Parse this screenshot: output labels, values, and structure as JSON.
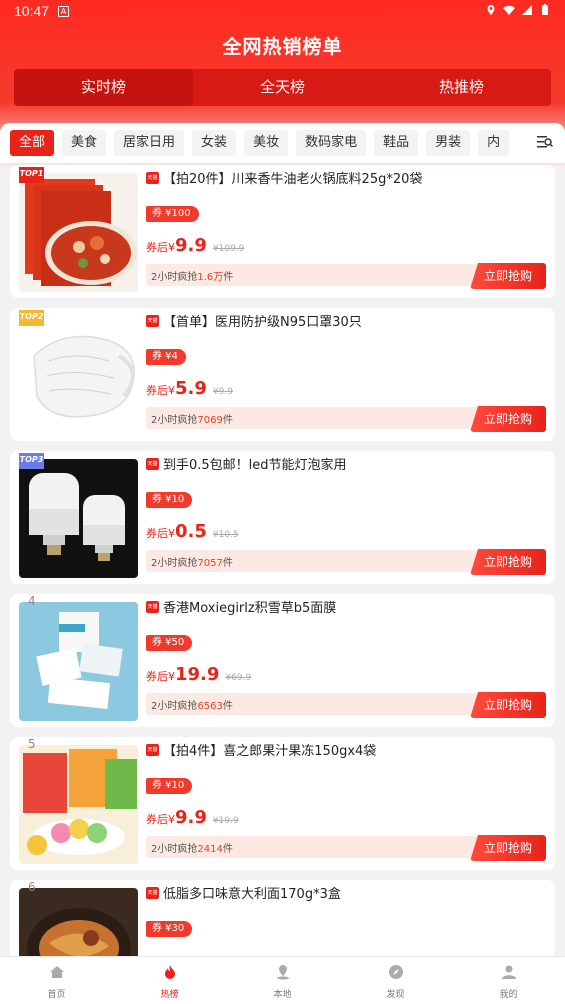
{
  "status": {
    "time": "10:47",
    "notif": "A"
  },
  "page_title": "全网热销榜单",
  "segments": [
    {
      "label": "实时榜",
      "active": true
    },
    {
      "label": "全天榜",
      "active": false
    },
    {
      "label": "热推榜",
      "active": false
    }
  ],
  "categories": [
    "全部",
    "美食",
    "居家日用",
    "女装",
    "美妆",
    "数码家电",
    "鞋品",
    "男装",
    "内"
  ],
  "badges": {
    "top1": "TOP1",
    "top2": "TOP2",
    "top3": "TOP3"
  },
  "shop_tag": "天猫",
  "labels": {
    "after": "券后",
    "yen": "¥",
    "coupon_prefix": "券 ¥",
    "buy": "立即抢购",
    "sales_prefix": "2小时疯抢",
    "sales_suffix": "件"
  },
  "products": [
    {
      "rank": "1",
      "title": "【拍20件】川来香牛油老火锅底料25g*20袋",
      "coupon": "100",
      "price": "9.9",
      "orig": "¥109.9",
      "sales": "1.6万"
    },
    {
      "rank": "2",
      "title": "【首单】医用防护级N95口罩30只",
      "coupon": "4",
      "price": "5.9",
      "orig": "¥9.9",
      "sales": "7069"
    },
    {
      "rank": "3",
      "title": "到手0.5包邮！led节能灯泡家用",
      "coupon": "10",
      "price": "0.5",
      "orig": "¥10.5",
      "sales": "7057"
    },
    {
      "rank": "4",
      "title": "香港Moxiegirlz积雪草b5面膜",
      "coupon": "50",
      "price": "19.9",
      "orig": "¥69.9",
      "sales": "6563"
    },
    {
      "rank": "5",
      "title": "【拍4件】喜之郎果汁果冻150gx4袋",
      "coupon": "10",
      "price": "9.9",
      "orig": "¥19.9",
      "sales": "2414"
    },
    {
      "rank": "6",
      "title": "低脂多口味意大利面170g*3盒",
      "coupon": "30",
      "price": "",
      "orig": "",
      "sales": ""
    }
  ],
  "tabbar": [
    {
      "label": "首页",
      "icon": "home-icon",
      "active": false
    },
    {
      "label": "热榜",
      "icon": "flame-icon",
      "active": true
    },
    {
      "label": "本地",
      "icon": "location-icon",
      "active": false
    },
    {
      "label": "发现",
      "icon": "compass-icon",
      "active": false
    },
    {
      "label": "我的",
      "icon": "user-icon",
      "active": false
    }
  ],
  "colors": {
    "brand": "#e8231a",
    "header": "#ff2a22"
  }
}
